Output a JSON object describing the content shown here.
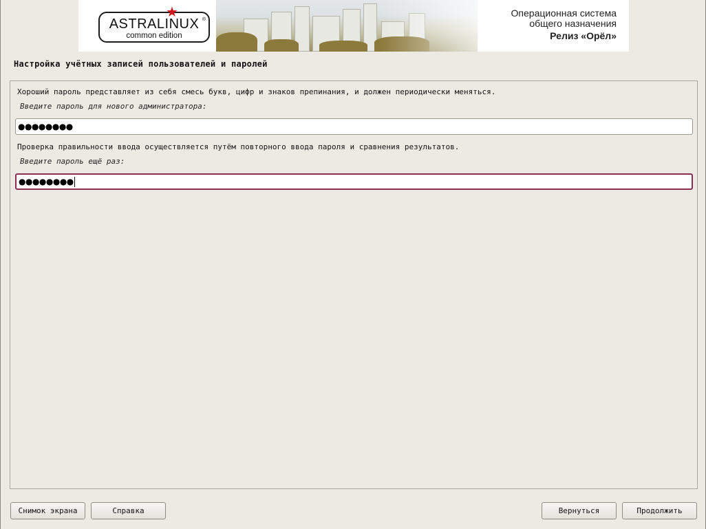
{
  "banner": {
    "logo_name": "ASTRALINUX",
    "logo_edition": "common edition",
    "logo_reg": "®",
    "os_line1": "Операционная система",
    "os_line2": "общего назначения",
    "release": "Релиз «Орёл»"
  },
  "page": {
    "title": "Настройка учётных записей пользователей и паролей"
  },
  "form": {
    "info1": "Хороший пароль представляет из себя смесь букв, цифр и знаков препинания, и должен периодически меняться.",
    "prompt1": "Введите пароль для нового администратора:",
    "password1_masked": "●●●●●●●●",
    "info2": "Проверка правильности ввода осуществляется путём повторного ввода пароля и сравнения результатов.",
    "prompt2": "Введите пароль ещё раз:",
    "password2_masked": "●●●●●●●●"
  },
  "buttons": {
    "screenshot": "Снимок экрана",
    "help": "Справка",
    "back": "Вернуться",
    "continue": "Продолжить"
  },
  "colors": {
    "background": "#edeae4",
    "focus_border": "#8a2f52",
    "logo_star": "#d0141c"
  }
}
